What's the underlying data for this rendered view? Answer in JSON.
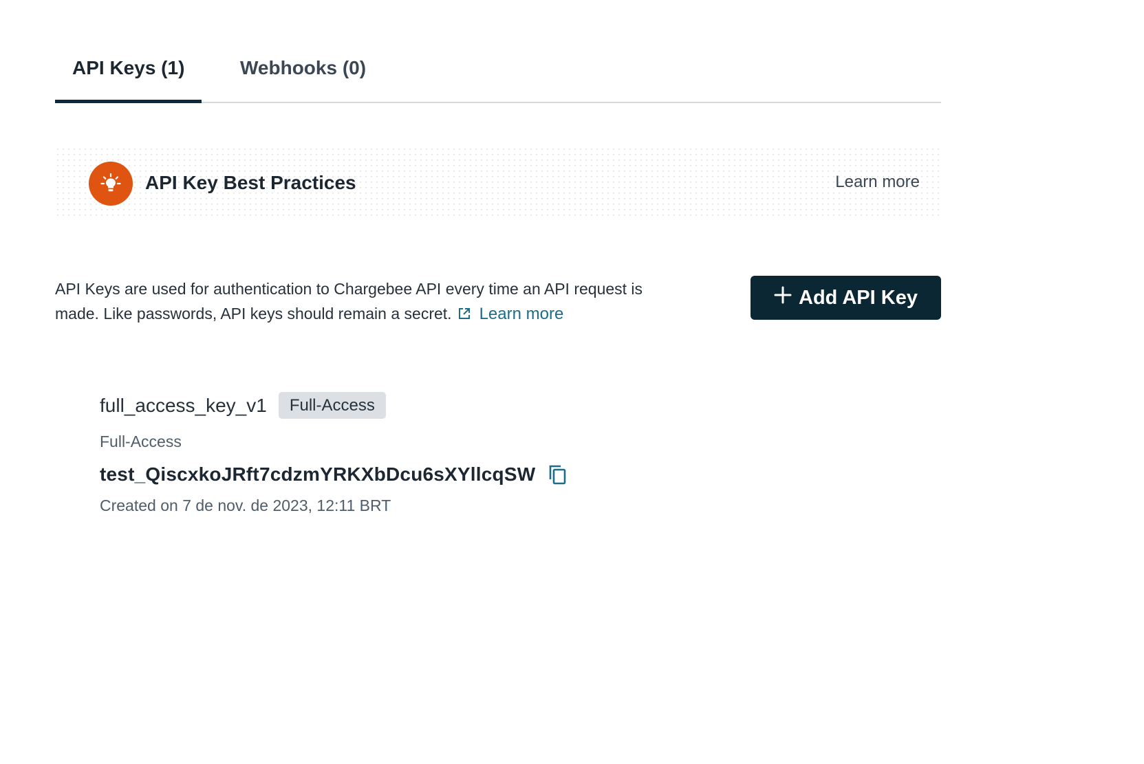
{
  "tabs": [
    {
      "label": "API Keys (1)",
      "active": true
    },
    {
      "label": "Webhooks (0)",
      "active": false
    }
  ],
  "banner": {
    "icon": "lightbulb-icon",
    "title": "API Key Best Practices",
    "link": "Learn more"
  },
  "description": {
    "text": "API Keys are used for authentication to Chargebee API every time an API request is made. Like passwords, API keys should remain a secret.",
    "link_icon": "external-link-icon",
    "link": "Learn more"
  },
  "add_button": {
    "icon": "plus-icon",
    "label": "Add API Key"
  },
  "api_key": {
    "name": "full_access_key_v1",
    "badge": "Full-Access",
    "type": "Full-Access",
    "value": "test_QiscxkoJRft7cdzmYRKXbDcu6sXYllcqSW",
    "copy_icon": "copy-icon",
    "created": "Created on 7 de nov. de 2023, 12:11 BRT"
  },
  "colors": {
    "accent_orange": "#de5410",
    "primary_dark": "#0b2734",
    "link_blue": "#1d6d8a"
  }
}
